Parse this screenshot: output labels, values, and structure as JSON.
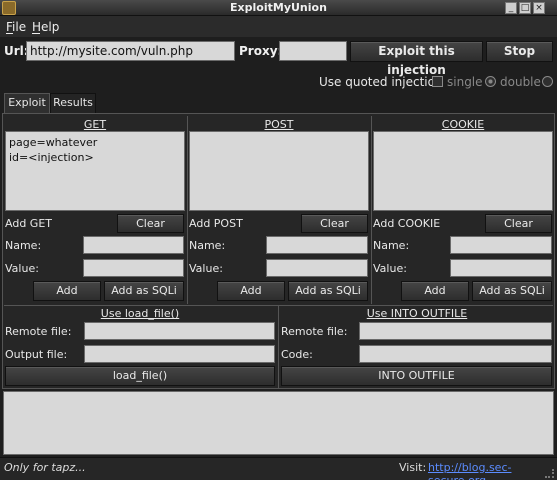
{
  "window": {
    "title": "ExploitMyUnion"
  },
  "menu": {
    "file": "File",
    "help": "Help"
  },
  "toolbar": {
    "url_label": "Url:",
    "url_value": "http://mysite.com/vuln.php",
    "proxy_label": "Proxy:",
    "proxy_value": "",
    "exploit_button": "Exploit this injection",
    "stop_button": "Stop"
  },
  "quoting": {
    "label": "Use quoted injection",
    "single_label": "single",
    "double_label": "double",
    "selected": "double"
  },
  "tabs": [
    {
      "label": "Exploit",
      "active": true
    },
    {
      "label": "Results",
      "active": false
    }
  ],
  "columns": {
    "get": {
      "header": "GET",
      "content": "page=whatever\nid=<injection>",
      "add_label": "Add GET",
      "clear_button": "Clear",
      "name_label": "Name:",
      "value_label": "Value:",
      "add_button": "Add",
      "add_sqli_button": "Add as SQLi"
    },
    "post": {
      "header": "POST",
      "content": "",
      "add_label": "Add POST",
      "clear_button": "Clear",
      "name_label": "Name:",
      "value_label": "Value:",
      "add_button": "Add",
      "add_sqli_button": "Add as SQLi"
    },
    "cookie": {
      "header": "COOKIE",
      "content": "",
      "add_label": "Add COOKIE",
      "clear_button": "Clear",
      "name_label": "Name:",
      "value_label": "Value:",
      "add_button": "Add",
      "add_sqli_button": "Add as SQLi"
    }
  },
  "load_file": {
    "header": "Use load_file()",
    "remote_label": "Remote file:",
    "output_label": "Output file:",
    "button": "load_file()"
  },
  "outfile": {
    "header": "Use INTO OUTFILE",
    "remote_label": "Remote file:",
    "code_label": "Code:",
    "button": "INTO OUTFILE"
  },
  "status": {
    "text": "Only for tapz...",
    "visit_label": "Visit:",
    "visit_link": "http://blog.sec-secure.org"
  }
}
